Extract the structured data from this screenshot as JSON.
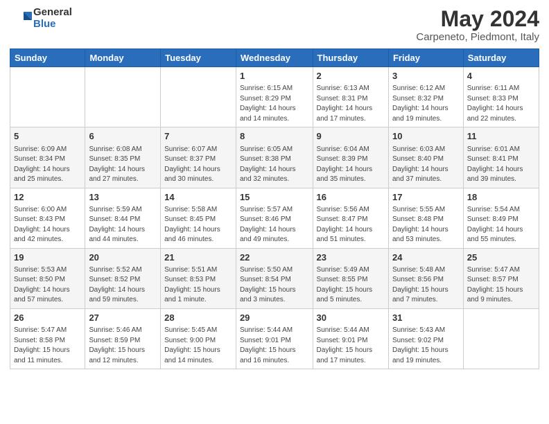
{
  "header": {
    "logo_general": "General",
    "logo_blue": "Blue",
    "title": "May 2024",
    "subtitle": "Carpeneto, Piedmont, Italy"
  },
  "calendar": {
    "days_of_week": [
      "Sunday",
      "Monday",
      "Tuesday",
      "Wednesday",
      "Thursday",
      "Friday",
      "Saturday"
    ],
    "weeks": [
      {
        "row": 1,
        "days": [
          {
            "num": "",
            "info": ""
          },
          {
            "num": "",
            "info": ""
          },
          {
            "num": "",
            "info": ""
          },
          {
            "num": "1",
            "info": "Sunrise: 6:15 AM\nSunset: 8:29 PM\nDaylight: 14 hours\nand 14 minutes."
          },
          {
            "num": "2",
            "info": "Sunrise: 6:13 AM\nSunset: 8:31 PM\nDaylight: 14 hours\nand 17 minutes."
          },
          {
            "num": "3",
            "info": "Sunrise: 6:12 AM\nSunset: 8:32 PM\nDaylight: 14 hours\nand 19 minutes."
          },
          {
            "num": "4",
            "info": "Sunrise: 6:11 AM\nSunset: 8:33 PM\nDaylight: 14 hours\nand 22 minutes."
          }
        ]
      },
      {
        "row": 2,
        "days": [
          {
            "num": "5",
            "info": "Sunrise: 6:09 AM\nSunset: 8:34 PM\nDaylight: 14 hours\nand 25 minutes."
          },
          {
            "num": "6",
            "info": "Sunrise: 6:08 AM\nSunset: 8:35 PM\nDaylight: 14 hours\nand 27 minutes."
          },
          {
            "num": "7",
            "info": "Sunrise: 6:07 AM\nSunset: 8:37 PM\nDaylight: 14 hours\nand 30 minutes."
          },
          {
            "num": "8",
            "info": "Sunrise: 6:05 AM\nSunset: 8:38 PM\nDaylight: 14 hours\nand 32 minutes."
          },
          {
            "num": "9",
            "info": "Sunrise: 6:04 AM\nSunset: 8:39 PM\nDaylight: 14 hours\nand 35 minutes."
          },
          {
            "num": "10",
            "info": "Sunrise: 6:03 AM\nSunset: 8:40 PM\nDaylight: 14 hours\nand 37 minutes."
          },
          {
            "num": "11",
            "info": "Sunrise: 6:01 AM\nSunset: 8:41 PM\nDaylight: 14 hours\nand 39 minutes."
          }
        ]
      },
      {
        "row": 3,
        "days": [
          {
            "num": "12",
            "info": "Sunrise: 6:00 AM\nSunset: 8:43 PM\nDaylight: 14 hours\nand 42 minutes."
          },
          {
            "num": "13",
            "info": "Sunrise: 5:59 AM\nSunset: 8:44 PM\nDaylight: 14 hours\nand 44 minutes."
          },
          {
            "num": "14",
            "info": "Sunrise: 5:58 AM\nSunset: 8:45 PM\nDaylight: 14 hours\nand 46 minutes."
          },
          {
            "num": "15",
            "info": "Sunrise: 5:57 AM\nSunset: 8:46 PM\nDaylight: 14 hours\nand 49 minutes."
          },
          {
            "num": "16",
            "info": "Sunrise: 5:56 AM\nSunset: 8:47 PM\nDaylight: 14 hours\nand 51 minutes."
          },
          {
            "num": "17",
            "info": "Sunrise: 5:55 AM\nSunset: 8:48 PM\nDaylight: 14 hours\nand 53 minutes."
          },
          {
            "num": "18",
            "info": "Sunrise: 5:54 AM\nSunset: 8:49 PM\nDaylight: 14 hours\nand 55 minutes."
          }
        ]
      },
      {
        "row": 4,
        "days": [
          {
            "num": "19",
            "info": "Sunrise: 5:53 AM\nSunset: 8:50 PM\nDaylight: 14 hours\nand 57 minutes."
          },
          {
            "num": "20",
            "info": "Sunrise: 5:52 AM\nSunset: 8:52 PM\nDaylight: 14 hours\nand 59 minutes."
          },
          {
            "num": "21",
            "info": "Sunrise: 5:51 AM\nSunset: 8:53 PM\nDaylight: 15 hours\nand 1 minute."
          },
          {
            "num": "22",
            "info": "Sunrise: 5:50 AM\nSunset: 8:54 PM\nDaylight: 15 hours\nand 3 minutes."
          },
          {
            "num": "23",
            "info": "Sunrise: 5:49 AM\nSunset: 8:55 PM\nDaylight: 15 hours\nand 5 minutes."
          },
          {
            "num": "24",
            "info": "Sunrise: 5:48 AM\nSunset: 8:56 PM\nDaylight: 15 hours\nand 7 minutes."
          },
          {
            "num": "25",
            "info": "Sunrise: 5:47 AM\nSunset: 8:57 PM\nDaylight: 15 hours\nand 9 minutes."
          }
        ]
      },
      {
        "row": 5,
        "days": [
          {
            "num": "26",
            "info": "Sunrise: 5:47 AM\nSunset: 8:58 PM\nDaylight: 15 hours\nand 11 minutes."
          },
          {
            "num": "27",
            "info": "Sunrise: 5:46 AM\nSunset: 8:59 PM\nDaylight: 15 hours\nand 12 minutes."
          },
          {
            "num": "28",
            "info": "Sunrise: 5:45 AM\nSunset: 9:00 PM\nDaylight: 15 hours\nand 14 minutes."
          },
          {
            "num": "29",
            "info": "Sunrise: 5:44 AM\nSunset: 9:01 PM\nDaylight: 15 hours\nand 16 minutes."
          },
          {
            "num": "30",
            "info": "Sunrise: 5:44 AM\nSunset: 9:01 PM\nDaylight: 15 hours\nand 17 minutes."
          },
          {
            "num": "31",
            "info": "Sunrise: 5:43 AM\nSunset: 9:02 PM\nDaylight: 15 hours\nand 19 minutes."
          },
          {
            "num": "",
            "info": ""
          }
        ]
      }
    ]
  }
}
